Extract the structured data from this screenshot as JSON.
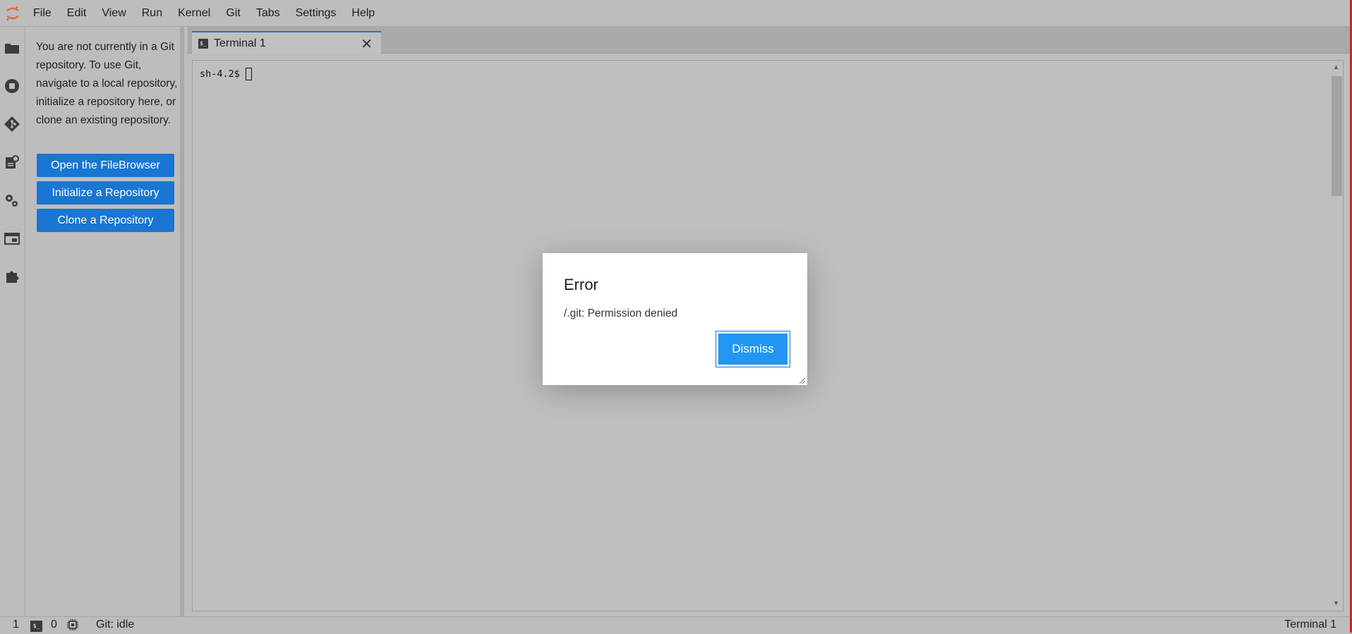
{
  "menu": {
    "items": [
      "File",
      "Edit",
      "View",
      "Run",
      "Kernel",
      "Git",
      "Tabs",
      "Settings",
      "Help"
    ]
  },
  "activity_icons": [
    "folder-icon",
    "stop-circle-icon",
    "git-icon",
    "property-inspector-icon",
    "settings-gear-icon",
    "tabs-icon",
    "extension-puzzle-icon"
  ],
  "git_panel": {
    "message": "You are not currently in a Git repository. To use Git, navigate to a local repository, initialize a repository here, or clone an existing repository.",
    "buttons": [
      "Open the FileBrowser",
      "Initialize a Repository",
      "Clone a Repository"
    ]
  },
  "tab": {
    "label": "Terminal 1",
    "close": "✕",
    "icon_text": "$_"
  },
  "terminal": {
    "prompt": "sh-4.2$"
  },
  "dialog": {
    "title": "Error",
    "message": "/.git: Permission denied",
    "button": "Dismiss"
  },
  "status": {
    "count1": "1",
    "count2": "0",
    "git_status": "Git: idle",
    "active": "Terminal 1"
  },
  "colors": {
    "accent": "#1976d2",
    "dismiss": "#2196f3",
    "edge": "#c62828"
  }
}
